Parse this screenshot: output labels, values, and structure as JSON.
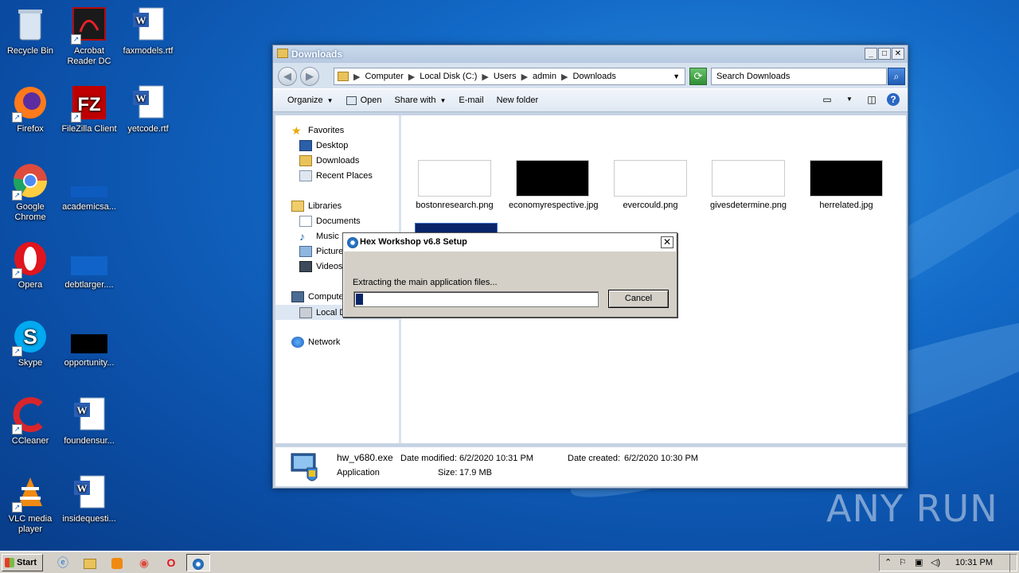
{
  "desktop": {
    "icons": [
      {
        "label": "Recycle Bin"
      },
      {
        "label": "Acrobat Reader DC"
      },
      {
        "label": "faxmodels.rtf"
      },
      {
        "label": "Firefox"
      },
      {
        "label": "FileZilla Client"
      },
      {
        "label": "yetcode.rtf"
      },
      {
        "label": "Google Chrome"
      },
      {
        "label": "academicsa..."
      },
      {
        "label": "Opera"
      },
      {
        "label": "debtlarger...."
      },
      {
        "label": "Skype"
      },
      {
        "label": "opportunity..."
      },
      {
        "label": "CCleaner"
      },
      {
        "label": "foundensur..."
      },
      {
        "label": "VLC media player"
      },
      {
        "label": "insidequesti..."
      }
    ]
  },
  "explorer": {
    "title": "Downloads",
    "window_buttons": {
      "minimize": "_",
      "maximize": "□",
      "close": "✕"
    },
    "breadcrumb": [
      "Computer",
      "Local Disk (C:)",
      "Users",
      "admin",
      "Downloads"
    ],
    "search_placeholder": "Search Downloads",
    "toolbar": {
      "organize": "Organize",
      "open": "Open",
      "share_with": "Share with",
      "email": "E-mail",
      "new_folder": "New folder"
    },
    "nav": {
      "favorites": "Favorites",
      "desktop": "Desktop",
      "downloads": "Downloads",
      "recent_places": "Recent Places",
      "libraries": "Libraries",
      "documents": "Documents",
      "music": "Music",
      "pictures": "Picture",
      "videos": "Videos",
      "computer": "Compute",
      "local_disk": "Local D",
      "network": "Network"
    },
    "files": [
      {
        "name": "bostonresearch.png"
      },
      {
        "name": "economyrespective.jpg"
      },
      {
        "name": "evercould.png"
      },
      {
        "name": "givesdetermine.png"
      },
      {
        "name": "herrelated.jpg"
      }
    ],
    "details": {
      "filename": "hw_v680.exe",
      "type": "Application",
      "modified_label": "Date modified:",
      "modified_value": "6/2/2020 10:31 PM",
      "size_label": "Size:",
      "size_value": "17.9 MB",
      "created_label": "Date created:",
      "created_value": "6/2/2020 10:30 PM"
    }
  },
  "setup_dialog": {
    "title": "Hex Workshop v6.8 Setup",
    "close": "✕",
    "message": "Extracting the main application files...",
    "progress": 0.03,
    "cancel": "Cancel"
  },
  "taskbar": {
    "start": "Start",
    "clock": "10:31 PM"
  },
  "watermark": "ANY RUN"
}
